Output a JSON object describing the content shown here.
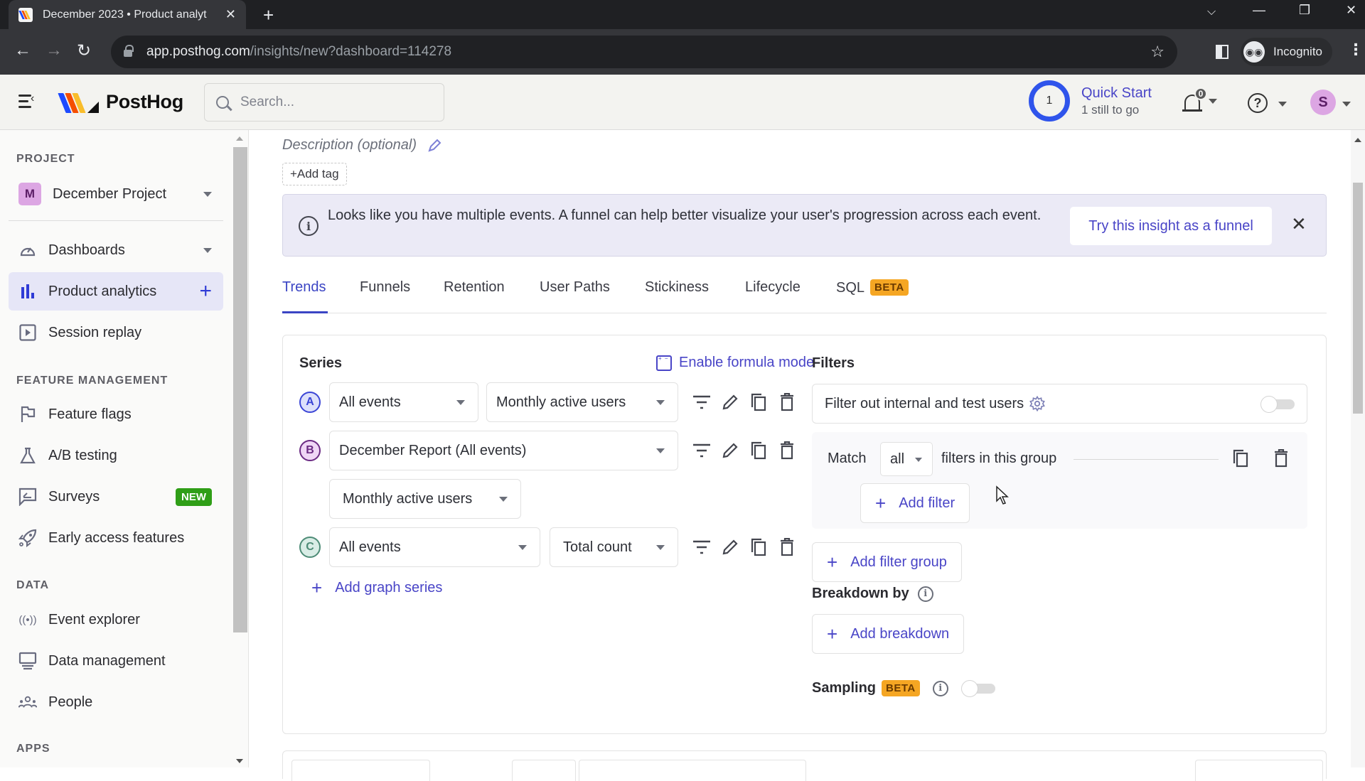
{
  "browser": {
    "tab_title": "December 2023 • Product analyt",
    "url_host": "app.posthog.com",
    "url_path": "/insights/new?dashboard=114278",
    "profile_label": "Incognito"
  },
  "topbar": {
    "brand": "PostHog",
    "search_placeholder": "Search...",
    "quickstart": {
      "title": "Quick Start",
      "subtitle": "1 still to go",
      "remaining": "1"
    },
    "notifications_count": "0",
    "avatar_initial": "S"
  },
  "sidebar": {
    "sections": {
      "project": "PROJECT",
      "feature_management": "FEATURE MANAGEMENT",
      "data": "DATA",
      "apps": "APPS"
    },
    "project": {
      "initial": "M",
      "name": "December Project"
    },
    "items": [
      {
        "label": "Dashboards",
        "icon": "dashboard-gauge-icon"
      },
      {
        "label": "Product analytics",
        "icon": "bar-chart-icon",
        "active": true
      },
      {
        "label": "Session replay",
        "icon": "play-box-icon"
      },
      {
        "label": "Feature flags",
        "icon": "flag-icon"
      },
      {
        "label": "A/B testing",
        "icon": "flask-icon"
      },
      {
        "label": "Surveys",
        "icon": "survey-icon",
        "badge": "NEW"
      },
      {
        "label": "Early access features",
        "icon": "rocket-icon"
      },
      {
        "label": "Event explorer",
        "icon": "broadcast-icon"
      },
      {
        "label": "Data management",
        "icon": "database-monitor-icon"
      },
      {
        "label": "People",
        "icon": "people-icon"
      }
    ]
  },
  "header": {
    "description_placeholder": "Description (optional)",
    "add_tag": "+Add tag"
  },
  "banner": {
    "message": "Looks like you have multiple events. A funnel can help better visualize your user's progression across each event.",
    "action": "Try this insight as a funnel"
  },
  "insight_tabs": [
    {
      "label": "Trends",
      "active": true
    },
    {
      "label": "Funnels"
    },
    {
      "label": "Retention"
    },
    {
      "label": "User Paths"
    },
    {
      "label": "Stickiness"
    },
    {
      "label": "Lifecycle"
    },
    {
      "label": "SQL",
      "badge": "BETA"
    }
  ],
  "series": {
    "title": "Series",
    "formula_mode": "Enable formula mode",
    "rows": [
      {
        "letter": "A",
        "event": "All events",
        "math": "Monthly active users"
      },
      {
        "letter": "B",
        "event": "December Report (All events)",
        "math": "Monthly active users"
      },
      {
        "letter": "C",
        "event": "All events",
        "math": "Total count"
      }
    ],
    "add_series": "Add graph series"
  },
  "filters": {
    "title": "Filters",
    "internal_users": "Filter out internal and test users",
    "internal_users_enabled": false,
    "match_prefix": "Match",
    "match_value": "all",
    "match_suffix": "filters in this group",
    "add_filter": "Add filter",
    "add_filter_group": "Add filter group",
    "breakdown_title": "Breakdown by",
    "add_breakdown": "Add breakdown",
    "sampling_title": "Sampling",
    "sampling_badge": "BETA",
    "sampling_enabled": false
  }
}
